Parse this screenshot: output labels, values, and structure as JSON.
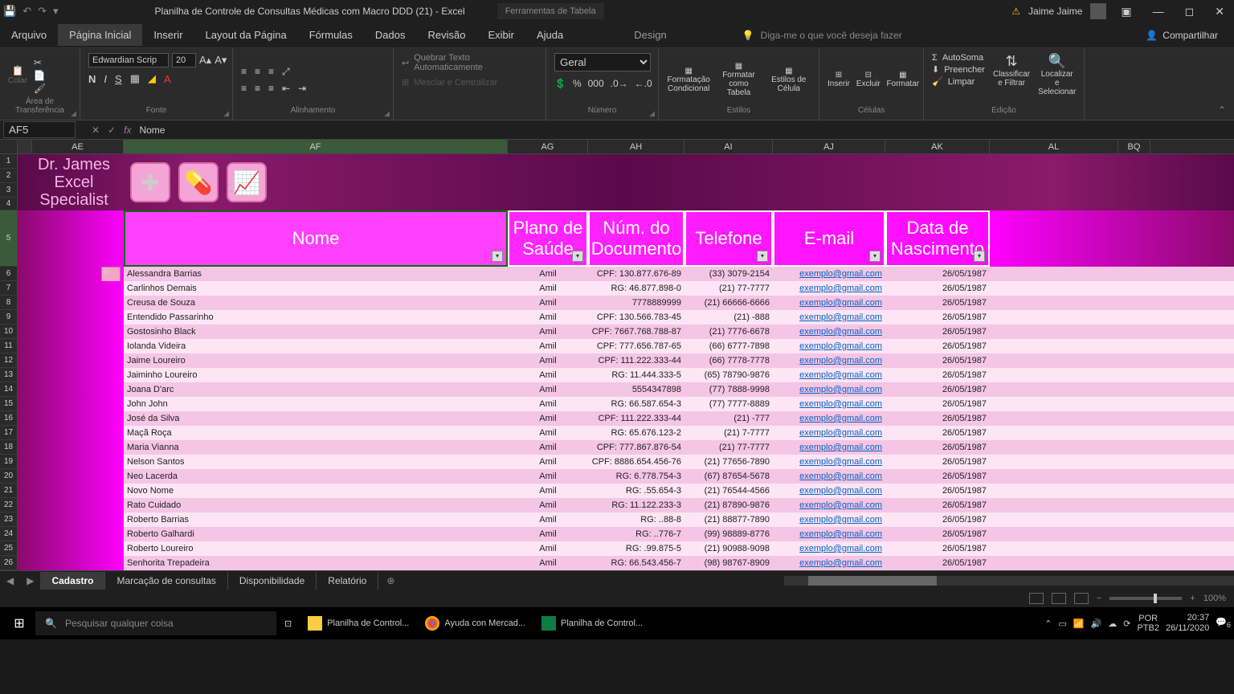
{
  "titlebar": {
    "title": "Planilha de Controle de Consultas Médicas com Macro DDD (21)  -  Excel",
    "tabletools": "Ferramentas de Tabela",
    "username": "Jaime Jaime"
  },
  "menu": {
    "arquivo": "Arquivo",
    "pagina": "Página Inicial",
    "inserir": "Inserir",
    "layout": "Layout da Página",
    "formulas": "Fórmulas",
    "dados": "Dados",
    "revisao": "Revisão",
    "exibir": "Exibir",
    "ajuda": "Ajuda",
    "design": "Design",
    "tellme": "Diga-me o que você deseja fazer",
    "share": "Compartilhar"
  },
  "ribbon": {
    "clipboard": {
      "label": "Área de Transferência",
      "paste": "Colar"
    },
    "font": {
      "label": "Fonte",
      "name": "Edwardian Scrip",
      "size": "20"
    },
    "alignment": {
      "label": "Alinhamento",
      "wrap": "Quebrar Texto Automaticamente",
      "merge": "Mesclar e Centralizar"
    },
    "number": {
      "label": "Número",
      "format": "Geral"
    },
    "styles": {
      "label": "Estilos",
      "cond": "Formatação Condicional",
      "table": "Formatar como Tabela",
      "cell": "Estilos de Célula"
    },
    "cells": {
      "label": "Células",
      "insert": "Inserir",
      "delete": "Excluir",
      "format": "Formatar"
    },
    "editing": {
      "label": "Edição",
      "autosum": "AutoSoma",
      "fill": "Preencher",
      "clear": "Limpar",
      "sort": "Classificar e Filtrar",
      "find": "Localizar e Selecionar"
    }
  },
  "namebox": "AF5",
  "formula": "Nome",
  "cols": {
    "ae": "AE",
    "af": "AF",
    "ag": "AG",
    "ah": "AH",
    "ai": "AI",
    "aj": "AJ",
    "ak": "AK",
    "al": "AL",
    "bq": "BQ"
  },
  "banner": {
    "line1": "Dr. James",
    "line2": "Excel Specialist"
  },
  "headers": {
    "nome": "Nome",
    "plano": "Plano de Saúde",
    "doc": "Núm. do Documento",
    "tel": "Telefone",
    "email": "E-mail",
    "data": "Data de Nascimento"
  },
  "rows": [
    {
      "n": 6,
      "nome": "Alessandra Barrias",
      "plano": "Amil",
      "doc": "CPF: 130.877.676-89",
      "tel": "(33) 3079-2154",
      "email": "exemplo@gmail.com",
      "data": "26/05/1987"
    },
    {
      "n": 7,
      "nome": "Carlinhos Demais",
      "plano": "Amil",
      "doc": "RG: 46.877.898-0",
      "tel": "(21) 77-7777",
      "email": "exemplo@gmail.com",
      "data": "26/05/1987"
    },
    {
      "n": 8,
      "nome": "Creusa de Souza",
      "plano": "Amil",
      "doc": "7778889999",
      "tel": "(21) 66666-6666",
      "email": "exemplo@gmail.com",
      "data": "26/05/1987"
    },
    {
      "n": 9,
      "nome": "Entendido Passarinho",
      "plano": "Amil",
      "doc": "CPF: 130.566.783-45",
      "tel": "(21) -888",
      "email": "exemplo@gmail.com",
      "data": "26/05/1987"
    },
    {
      "n": 10,
      "nome": "Gostosinho Black",
      "plano": "Amil",
      "doc": "CPF: 7667.768.788-87",
      "tel": "(21) 7776-6678",
      "email": "exemplo@gmail.com",
      "data": "26/05/1987"
    },
    {
      "n": 11,
      "nome": "Iolanda Videira",
      "plano": "Amil",
      "doc": "CPF: 777.656.787-65",
      "tel": "(66) 6777-7898",
      "email": "exemplo@gmail.com",
      "data": "26/05/1987"
    },
    {
      "n": 12,
      "nome": "Jaime Loureiro",
      "plano": "Amil",
      "doc": "CPF: 111.222.333-44",
      "tel": "(66) 7778-7778",
      "email": "exemplo@gmail.com",
      "data": "26/05/1987"
    },
    {
      "n": 13,
      "nome": "Jaiminho Loureiro",
      "plano": "Amil",
      "doc": "RG: 11.444.333-5",
      "tel": "(65) 78790-9876",
      "email": "exemplo@gmail.com",
      "data": "26/05/1987"
    },
    {
      "n": 14,
      "nome": "Joana D'arc",
      "plano": "Amil",
      "doc": "5554347898",
      "tel": "(77) 7888-9998",
      "email": "exemplo@gmail.com",
      "data": "26/05/1987"
    },
    {
      "n": 15,
      "nome": "John John",
      "plano": "Amil",
      "doc": "RG: 66.587.654-3",
      "tel": "(77) 7777-8889",
      "email": "exemplo@gmail.com",
      "data": "26/05/1987"
    },
    {
      "n": 16,
      "nome": "José da Silva",
      "plano": "Amil",
      "doc": "CPF: 111.222.333-44",
      "tel": "(21) -777",
      "email": "exemplo@gmail.com",
      "data": "26/05/1987"
    },
    {
      "n": 17,
      "nome": "Maçã Roça",
      "plano": "Amil",
      "doc": "RG: 65.676.123-2",
      "tel": "(21) 7-7777",
      "email": "exemplo@gmail.com",
      "data": "26/05/1987"
    },
    {
      "n": 18,
      "nome": "Maria Vianna",
      "plano": "Amil",
      "doc": "CPF: 777.867.876-54",
      "tel": "(21) 77-7777",
      "email": "exemplo@gmail.com",
      "data": "26/05/1987"
    },
    {
      "n": 19,
      "nome": "Nelson Santos",
      "plano": "Amil",
      "doc": "CPF: 8886.654.456-76",
      "tel": "(21) 77656-7890",
      "email": "exemplo@gmail.com",
      "data": "26/05/1987"
    },
    {
      "n": 20,
      "nome": "Neo Lacerda",
      "plano": "Amil",
      "doc": "RG: 6.778.754-3",
      "tel": "(67) 87654-5678",
      "email": "exemplo@gmail.com",
      "data": "26/05/1987"
    },
    {
      "n": 21,
      "nome": "Novo Nome",
      "plano": "Amil",
      "doc": "RG: .55.654-3",
      "tel": "(21) 76544-4566",
      "email": "exemplo@gmail.com",
      "data": "26/05/1987"
    },
    {
      "n": 22,
      "nome": "Rato Cuidado",
      "plano": "Amil",
      "doc": "RG: 11.122.233-3",
      "tel": "(21) 87890-9876",
      "email": "exemplo@gmail.com",
      "data": "26/05/1987"
    },
    {
      "n": 23,
      "nome": "Roberto Barrias",
      "plano": "Amil",
      "doc": "RG: ..88-8",
      "tel": "(21) 88877-7890",
      "email": "exemplo@gmail.com",
      "data": "26/05/1987"
    },
    {
      "n": 24,
      "nome": "Roberto Galhardi",
      "plano": "Amil",
      "doc": "RG: ..776-7",
      "tel": "(99) 98889-8776",
      "email": "exemplo@gmail.com",
      "data": "26/05/1987"
    },
    {
      "n": 25,
      "nome": "Roberto Loureiro",
      "plano": "Amil",
      "doc": "RG: .99.875-5",
      "tel": "(21) 90988-9098",
      "email": "exemplo@gmail.com",
      "data": "26/05/1987"
    },
    {
      "n": 26,
      "nome": "Senhorita Trepadeira",
      "plano": "Amil",
      "doc": "RG: 66.543.456-7",
      "tel": "(98) 98767-8909",
      "email": "exemplo@gmail.com",
      "data": "26/05/1987"
    }
  ],
  "sheets": {
    "cadastro": "Cadastro",
    "marcacao": "Marcação de consultas",
    "disp": "Disponibilidade",
    "rel": "Relatório"
  },
  "status": {
    "zoom": "100%"
  },
  "taskbar": {
    "search": "Pesquisar qualquer coisa",
    "t1": "Planilha de Control...",
    "t2": "Ayuda con Mercad...",
    "t3": "Planilha de Control...",
    "lang": "POR",
    "kb": "PTB2",
    "time": "20:37",
    "date": "26/11/2020",
    "notif": "6"
  }
}
